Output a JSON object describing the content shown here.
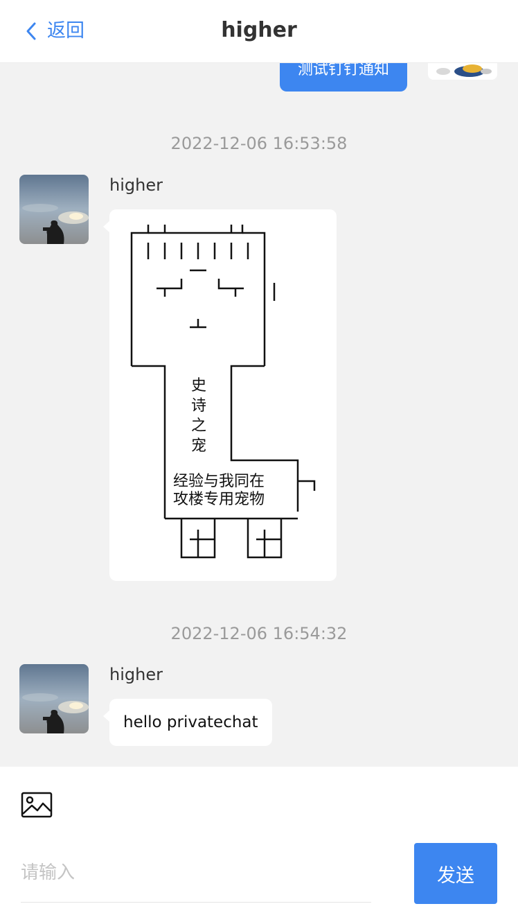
{
  "header": {
    "back_label": "返回",
    "title": "higher"
  },
  "messages": {
    "sent_top": {
      "text": "测试钉钉通知"
    },
    "group1": {
      "timestamp": "2022-12-06 16:53:58",
      "sender": "higher",
      "art": {
        "vertical_text": "史诗之宠",
        "line1": "经验与我同在",
        "line2": "攻楼专用宠物"
      }
    },
    "group2": {
      "timestamp": "2022-12-06 16:54:32",
      "sender": "higher",
      "text": "hello privatechat"
    }
  },
  "composer": {
    "image_icon": "image-icon",
    "placeholder": "请输入",
    "value": "",
    "send_label": "发送"
  },
  "colors": {
    "accent": "#3d86f0",
    "background": "#f2f2f2",
    "timestamp": "#9a9a9a"
  }
}
